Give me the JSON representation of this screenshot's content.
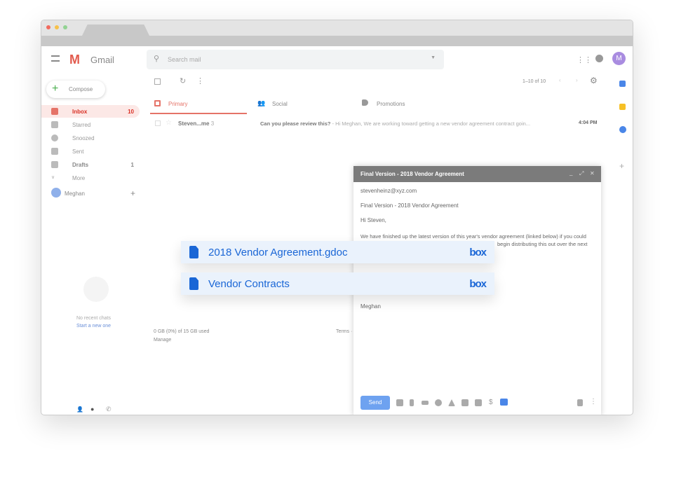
{
  "header": {
    "app_name": "Gmail",
    "search_placeholder": "Search mail",
    "avatar_letter": "M"
  },
  "compose_label": "Compose",
  "sidebar": {
    "items": [
      {
        "label": "Inbox",
        "count": "10",
        "icon": "inbox-icon"
      },
      {
        "label": "Starred",
        "count": "",
        "icon": "star-icon"
      },
      {
        "label": "Snoozed",
        "count": "",
        "icon": "clock-icon"
      },
      {
        "label": "Sent",
        "count": "",
        "icon": "send-icon"
      },
      {
        "label": "Drafts",
        "count": "1",
        "icon": "draft-icon"
      },
      {
        "label": "More",
        "count": "",
        "icon": "chevron-down-icon"
      }
    ],
    "user": "Meghan",
    "no_chats": "No recent chats",
    "start_chat": "Start a new one"
  },
  "toolbar": {
    "pagination": "1–10 of 10"
  },
  "tabs": [
    {
      "label": "Primary"
    },
    {
      "label": "Social"
    },
    {
      "label": "Promotions"
    }
  ],
  "emails": [
    {
      "sender": "Steven...me",
      "count": "3",
      "subject": "Can you please review this?",
      "snippet": " - Hi Meghan, We are working toward getting a new vendor agreement contract goin...",
      "time": "4:04 PM"
    }
  ],
  "footer": {
    "storage": "0 GB (0%) of 15 GB used",
    "manage": "Manage",
    "terms": "Terms ·"
  },
  "compose": {
    "title": "Final Version - 2018 Vendor Agreement",
    "to": "stevenheinz@xyz.com",
    "subject": "Final Version - 2018 Vendor Agreement",
    "greeting": "Hi Steven,",
    "body1": "We have finished up the latest version of this year's vendor agreement (linked below) if you could",
    "body2": "begin distributing this out over the next",
    "signature": "Meghan",
    "send": "Send"
  },
  "files": [
    {
      "name": "2018 Vendor Agreement.gdoc",
      "brand": "box"
    },
    {
      "name": "Vendor Contracts",
      "brand": "box"
    }
  ],
  "colors": {
    "accent": "#d93025",
    "send": "#6ea2f0",
    "box": "#1a66d6"
  }
}
